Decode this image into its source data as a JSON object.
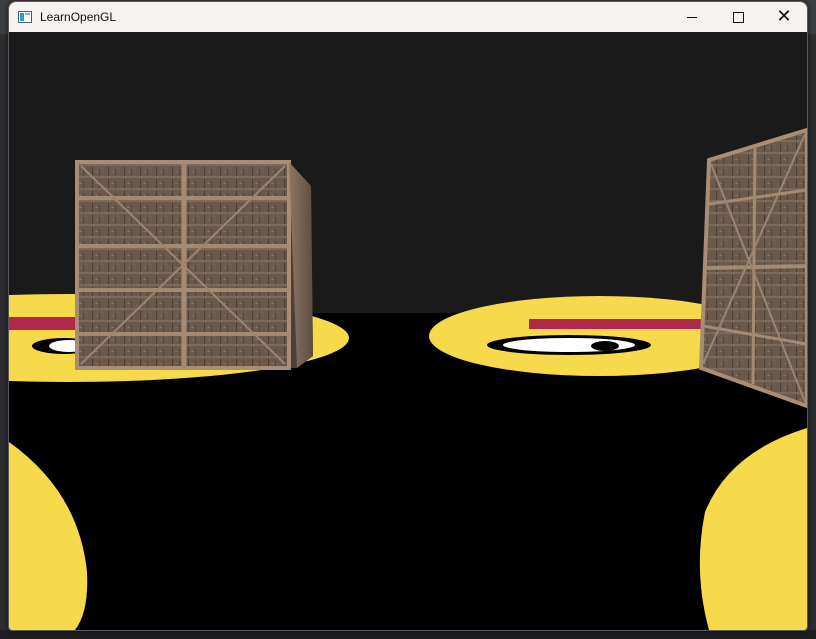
{
  "window": {
    "title": "LearnOpenGL",
    "icon": "opengl-app-icon"
  },
  "controls": {
    "minimize_icon": "minimize-icon",
    "maximize_icon": "maximize-icon",
    "close_icon": "close-icon",
    "close_glyph": "✕"
  },
  "scene": {
    "sky_color": "#1a1a1a",
    "floor_color": "#000000",
    "face_yellow": "#f7d94c",
    "face_red": "#b0294b",
    "crate_wood": "#6e5f52"
  }
}
